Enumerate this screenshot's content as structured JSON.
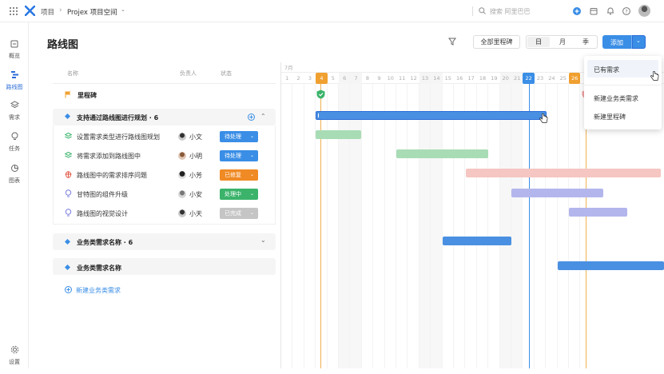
{
  "topbar": {
    "app_name": "项目",
    "separator": "›",
    "project_name": "Projex 项目空间",
    "search_placeholder": "搜索 阿里巴巴"
  },
  "sidebar": {
    "items": [
      {
        "label": "概览",
        "icon": "overview-icon"
      },
      {
        "label": "路线图",
        "icon": "roadmap-icon"
      },
      {
        "label": "需求",
        "icon": "layers-icon"
      },
      {
        "label": "任务",
        "icon": "bulb-icon"
      },
      {
        "label": "图表",
        "icon": "chart-icon"
      }
    ],
    "settings_label": "设置"
  },
  "header": {
    "title": "路线图",
    "milestones_button": "全部里程碑",
    "view_day": "日",
    "view_month": "月",
    "view_season": "季",
    "add_button": "添加"
  },
  "columns": {
    "name": "名称",
    "owner": "负责人",
    "status": "状态"
  },
  "milestone_row": {
    "label": "里程碑"
  },
  "group1": {
    "title": "支持通过路线图进行规划 · 6",
    "rows": [
      {
        "name": "设置需求类型进行路线图规划",
        "owner": "小文",
        "status": "待处理"
      },
      {
        "name": "将需求添加到路线图中",
        "owner": "小明",
        "status": "待处理"
      },
      {
        "name": "路线图中的需求排序问题",
        "owner": "小芳",
        "status": "已修复"
      },
      {
        "name": "甘特图的组件升级",
        "owner": "小安",
        "status": "处理中"
      },
      {
        "name": "路线图的视觉设计",
        "owner": "小天",
        "status": "已完成"
      }
    ]
  },
  "group2": {
    "title": "业务类需求名称 · 6"
  },
  "group3": {
    "title": "业务类需求名称"
  },
  "new_requirement": "新建业务类需求",
  "timeline": {
    "month": "7月",
    "days": [
      "1",
      "2",
      "3",
      "4",
      "5",
      "6",
      "7",
      "8",
      "9",
      "10",
      "11",
      "12",
      "13",
      "14",
      "15",
      "16",
      "17",
      "18",
      "19",
      "20",
      "21",
      "22",
      "23",
      "24",
      "25",
      "26"
    ],
    "today": "22",
    "milestone_day": "4",
    "second_marker": "26"
  },
  "dropdown": {
    "items": [
      "已有需求",
      "新建业务类需求",
      "新建里程碑"
    ]
  },
  "colors": {
    "accent": "#3a8ee6",
    "bar_blue": "#4a90e2",
    "bar_green": "#a8dcb5",
    "bar_pink": "#f5c6c2",
    "bar_purple": "#b3b6ec",
    "milestone_orange": "#f0a030",
    "status_pending": "#3a8ee6",
    "status_fixed": "#f08a24",
    "status_progress": "#3bb36b",
    "status_done": "#c5c5c5"
  }
}
